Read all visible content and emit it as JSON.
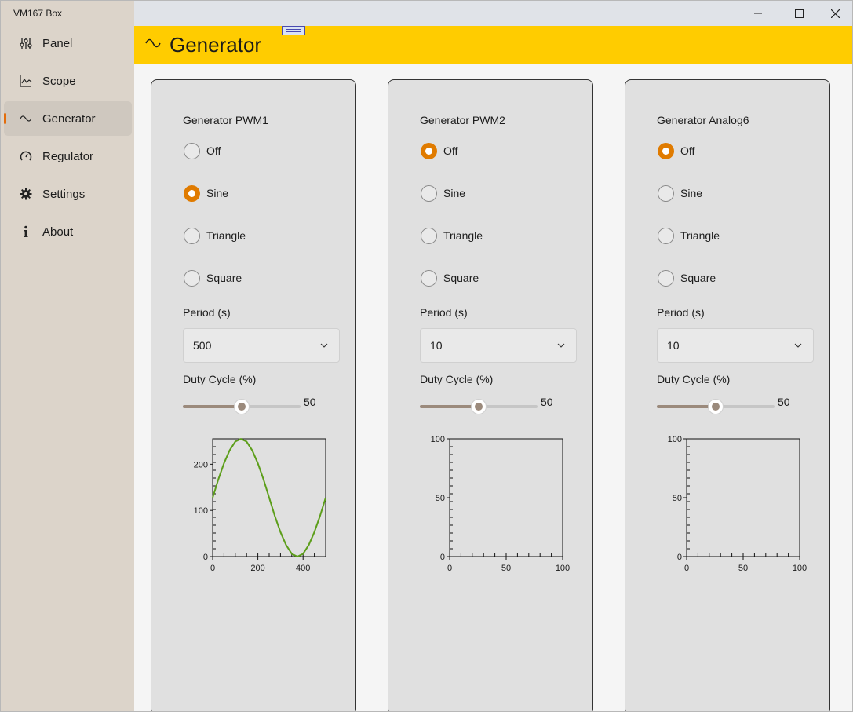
{
  "app": {
    "title": "VM167 Box"
  },
  "sidebar": {
    "items": [
      {
        "label": "Panel",
        "icon": "sliders-icon",
        "active": false
      },
      {
        "label": "Scope",
        "icon": "chart-line-icon",
        "active": false
      },
      {
        "label": "Generator",
        "icon": "wave-icon",
        "active": true
      },
      {
        "label": "Regulator",
        "icon": "gauge-icon",
        "active": false
      },
      {
        "label": "Settings",
        "icon": "gear-icon",
        "active": false
      },
      {
        "label": "About",
        "icon": "info-icon",
        "active": false
      }
    ]
  },
  "header": {
    "title": "Generator"
  },
  "accent": "#e07b00",
  "header_color": "#ffcc00",
  "generators": [
    {
      "title": "Generator PWM1",
      "options": [
        "Off",
        "Sine",
        "Triangle",
        "Square"
      ],
      "selected": "Sine",
      "period_label": "Period (s)",
      "period_value": "500",
      "duty_label": "Duty Cycle (%)",
      "duty_value": "50",
      "duty_fraction": 0.5
    },
    {
      "title": "Generator PWM2",
      "options": [
        "Off",
        "Sine",
        "Triangle",
        "Square"
      ],
      "selected": "Off",
      "period_label": "Period (s)",
      "period_value": "10",
      "duty_label": "Duty Cycle (%)",
      "duty_value": "50",
      "duty_fraction": 0.5
    },
    {
      "title": "Generator Analog6",
      "options": [
        "Off",
        "Sine",
        "Triangle",
        "Square"
      ],
      "selected": "Off",
      "period_label": "Period (s)",
      "period_value": "10",
      "duty_label": "Duty Cycle (%)",
      "duty_value": "50",
      "duty_fraction": 0.5
    }
  ],
  "chart_data": [
    {
      "type": "line",
      "title": "",
      "xlabel": "",
      "ylabel": "",
      "xlim": [
        0,
        500
      ],
      "ylim": [
        0,
        255
      ],
      "xticks": [
        "0",
        "200",
        "400"
      ],
      "yticks": [
        "0",
        "100",
        "200"
      ],
      "series": [
        {
          "color": "#5c9e1a",
          "x": [
            0,
            25,
            50,
            75,
            100,
            125,
            150,
            175,
            200,
            225,
            250,
            275,
            300,
            325,
            350,
            375,
            400,
            425,
            450,
            475,
            500
          ],
          "y": [
            127.5,
            167,
            202,
            230,
            249,
            255,
            249,
            230,
            202,
            167,
            127.5,
            88,
            53,
            25,
            6,
            0,
            6,
            25,
            53,
            88,
            127.5
          ]
        }
      ]
    },
    {
      "type": "line",
      "title": "",
      "xlabel": "",
      "ylabel": "",
      "xlim": [
        0,
        100
      ],
      "ylim": [
        0,
        100
      ],
      "xticks": [
        "0",
        "50",
        "100"
      ],
      "yticks": [
        "0",
        "50",
        "100"
      ],
      "series": []
    },
    {
      "type": "line",
      "title": "",
      "xlabel": "",
      "ylabel": "",
      "xlim": [
        0,
        100
      ],
      "ylim": [
        0,
        100
      ],
      "xticks": [
        "0",
        "50",
        "100"
      ],
      "yticks": [
        "0",
        "50",
        "100"
      ],
      "series": []
    }
  ]
}
